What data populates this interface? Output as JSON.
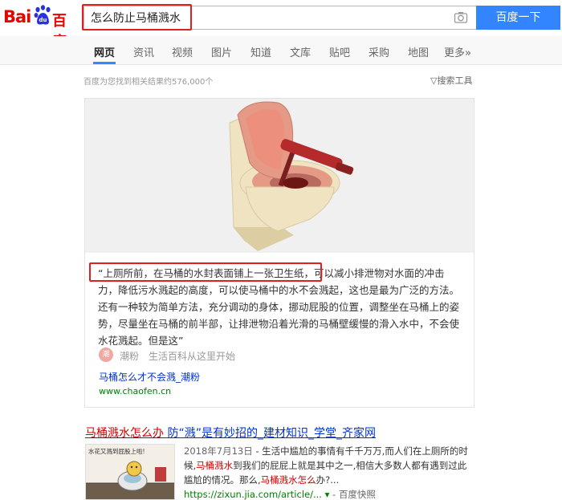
{
  "logo": {
    "bai": "Bai",
    "du": "百度"
  },
  "search": {
    "query": "怎么防止马桶溅水",
    "button": "百度一下"
  },
  "tabs": [
    {
      "label": "网页",
      "active": true
    },
    {
      "label": "资讯"
    },
    {
      "label": "视频"
    },
    {
      "label": "图片"
    },
    {
      "label": "知道"
    },
    {
      "label": "文库"
    },
    {
      "label": "贴吧"
    },
    {
      "label": "采购"
    },
    {
      "label": "地图"
    },
    {
      "label": "更多»"
    }
  ],
  "results_meta": {
    "count": "百度为您找到相关结果约576,000个",
    "tools": "搜索工具"
  },
  "card": {
    "text_highlight": "“上厕所前，在马桶的水封表面铺上一张卫生纸，",
    "text_rest": "可以减小排泄物对水面的冲击力，降低污水溅起的高度，可以使马桶中的水不会溅起，这也是最为广泛的方法。还有一种较为简单方法，充分调动的身体，挪动屁股的位置，调整坐在马桶上的姿势，尽量坐在马桶的前半部，让排泄物沿着光滑的马桶壁缓慢的滑入水中，不会使水花溅起。但是这”",
    "source_avatar": "潮",
    "source_name": "潮粉",
    "source_desc": "生活百科从这里开始",
    "link": "马桶怎么才不会溅_潮粉",
    "url": "www.chaofen.cn"
  },
  "result2": {
    "title_em": "马桶溅水怎么办",
    "title_rest": " 防“溅”是有妙招的_建材知识_学堂_齐家网",
    "date": "2018年7月13日",
    "desc1": " - 生活中尴尬的事情有千千万万,而人们在上厕所的时候,",
    "desc_em1": "马桶溅水",
    "desc2": "到我们的屁屁上就是其中之一,相信大多数人都有遇到过此尴尬的情况。那么,",
    "desc_em2": "马桶溅水怎么",
    "desc3": "办?...",
    "url": "https://zixun.jia.com/article/...",
    "snapshot": "百度快照",
    "thumb_text": "水花又溅到屁股上啦!"
  },
  "colors": {
    "brand_red": "#e10601",
    "search_blue": "#3385ff",
    "link_blue": "#0033cc",
    "url_green": "#008000",
    "highlight_red": "#e02020"
  }
}
